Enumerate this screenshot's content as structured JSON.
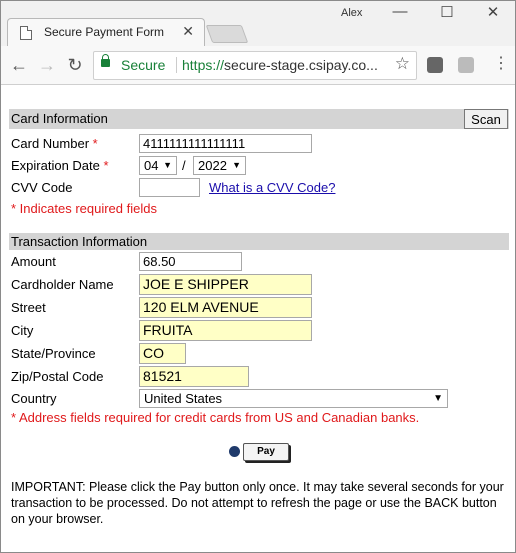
{
  "browser": {
    "user_name": "Alex",
    "tab_title": "Secure Payment Form",
    "secure_label": "Secure",
    "url_scheme": "https://",
    "url_rest": "secure-stage.csipay.co...",
    "colors": {
      "secure": "#188038",
      "required": "#e0191b",
      "link": "#1a0dab"
    },
    "icons": [
      "back-arrow-icon",
      "forward-arrow-icon",
      "reload-icon",
      "lock-icon",
      "star-icon",
      "extension-icon",
      "pdf-icon",
      "menu-icon"
    ]
  },
  "card_section": {
    "title": "Card Information",
    "scan_label": "Scan",
    "card_number_label": "Card Number",
    "card_number_value": "4111111111111111",
    "expiration_label": "Expiration Date",
    "exp_month": "04",
    "exp_separator": "/",
    "exp_year": "2022",
    "cvv_label": "CVV Code",
    "cvv_value": "",
    "cvv_link": "What is a CVV Code?",
    "required_marker": "*",
    "required_note": "* Indicates required fields"
  },
  "transaction_section": {
    "title": "Transaction Information",
    "amount_label": "Amount",
    "amount_value": "68.50",
    "name_label": "Cardholder Name",
    "name_value": "JOE E SHIPPER",
    "street_label": "Street",
    "street_value": "120 ELM AVENUE",
    "city_label": "City",
    "city_value": "FRUITA",
    "state_label": "State/Province",
    "state_value": "CO",
    "zip_label": "Zip/Postal Code",
    "zip_value": "81521",
    "country_label": "Country",
    "country_value": "United States",
    "address_note": "* Address fields required for credit cards from US and Canadian banks."
  },
  "pay_label": "Pay",
  "important_text": "IMPORTANT: Please click the Pay button only once. It may take several seconds for your transaction to be processed. Do not attempt to refresh the page or use the BACK button on your browser."
}
